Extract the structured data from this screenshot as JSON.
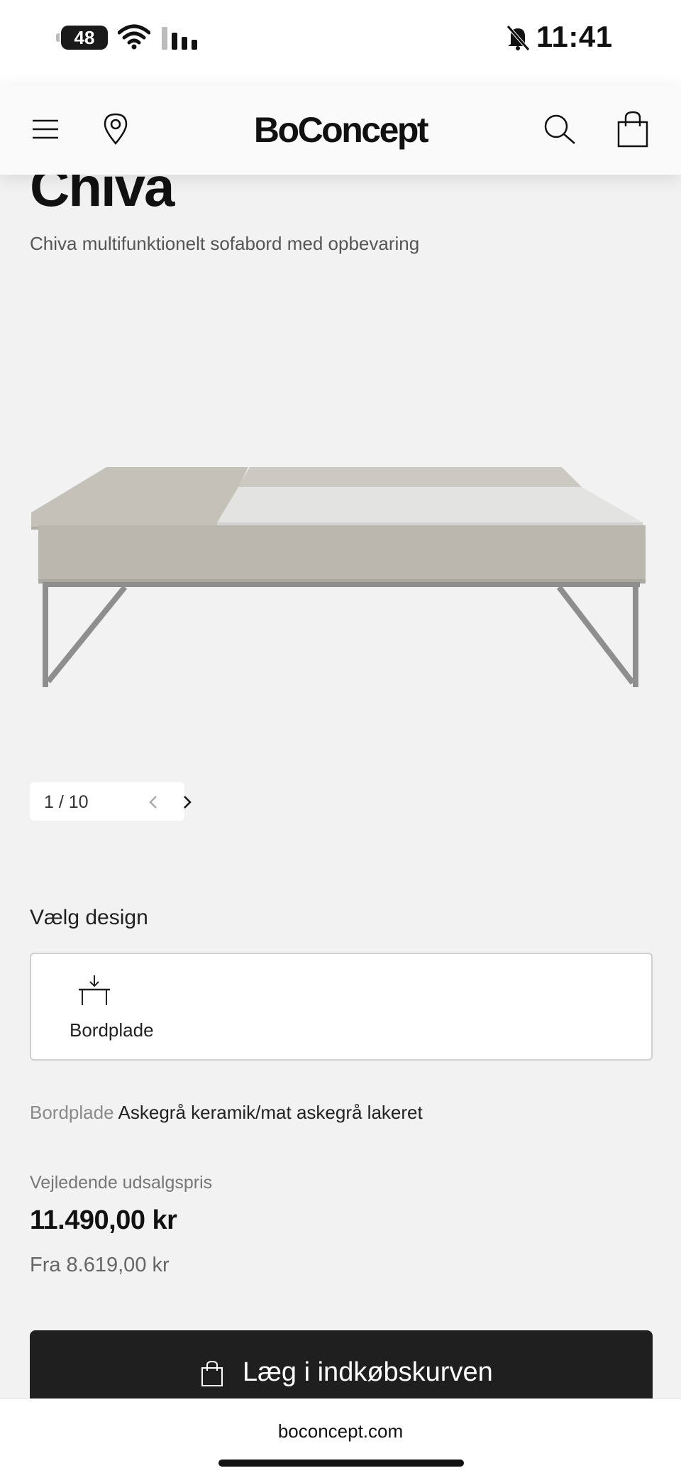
{
  "status_bar": {
    "battery": "48",
    "time": "11:41",
    "icons": [
      "wifi-icon",
      "signal-icon",
      "bell-muted-icon"
    ]
  },
  "header": {
    "logo": "BoConcept",
    "icons": [
      "menu-icon",
      "location-pin-icon",
      "search-icon",
      "shopping-bag-icon"
    ]
  },
  "product": {
    "title": "Chiva",
    "subtitle": "Chiva multifunktionelt sofabord med opbevaring"
  },
  "gallery": {
    "counter": "1 / 10"
  },
  "design": {
    "heading": "Vælg design",
    "option_label": "Bordplade"
  },
  "spec": {
    "key": "Bordplade",
    "value": "Askegrå keramik/mat askegrå lakeret"
  },
  "pricing": {
    "caption": "Vejledende udsalgspris",
    "price": "11.490,00 kr",
    "from": "Fra 8.619,00 kr"
  },
  "cart": {
    "label": "Læg i indkøbskurven"
  },
  "browser": {
    "url": "boconcept.com"
  },
  "colors": {
    "background": "#f2f2f2",
    "button": "#1f1f1f",
    "tabletop_ceramic": "#e3e3e1",
    "frame": "#bab8ae",
    "legs": "#8e8e8e"
  }
}
